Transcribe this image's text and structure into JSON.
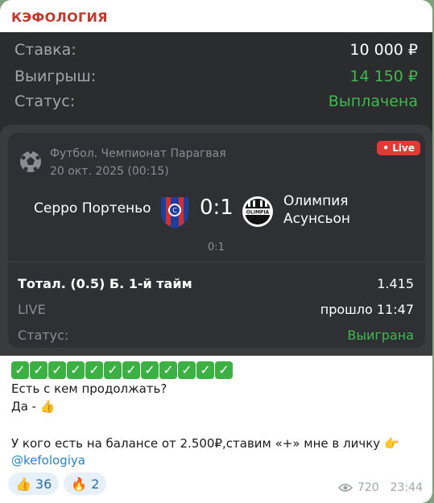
{
  "channel": {
    "name": "КЭФОЛОГИЯ"
  },
  "bet": {
    "stake_label": "Ставка:",
    "stake_value": "10 000 ₽",
    "win_label": "Выигрыш:",
    "win_value": "14 150 ₽",
    "status_label": "Статус:",
    "status_value": "Выплачена"
  },
  "match": {
    "league": "Футбол. Чемпионат Парагвая",
    "date": "20 окт. 2025 (00:15)",
    "live_badge": "• Live",
    "team1": "Серро Портеньо",
    "score": "0:1",
    "team2_line1": "Олимпия",
    "team2_line2": "Асунсьон",
    "score_small": "0:1",
    "market": "Тотал. (0.5) Б. 1-й тайм",
    "odds": "1.415",
    "live_label": "LIVE",
    "elapsed": "прошло 11:47",
    "status_label": "Статус:",
    "status_value": "Выиграна",
    "crest2_text": "OLIMPIA"
  },
  "message": {
    "line1": "Есть с кем продолжать?",
    "line2": "Да - ",
    "line3": "У кого есть на балансе от 2.500₽,ставим «+» мне в личку ",
    "link": "@kefologiya",
    "check_count": 12
  },
  "reactions": [
    {
      "emoji": "👍",
      "count": "36"
    },
    {
      "emoji": "🔥",
      "count": "2"
    }
  ],
  "meta": {
    "views": "720",
    "time": "23:44"
  },
  "colors": {
    "green": "#3fb950",
    "accent": "#c0392b",
    "live": "#e53935",
    "link": "#2b82c9"
  }
}
